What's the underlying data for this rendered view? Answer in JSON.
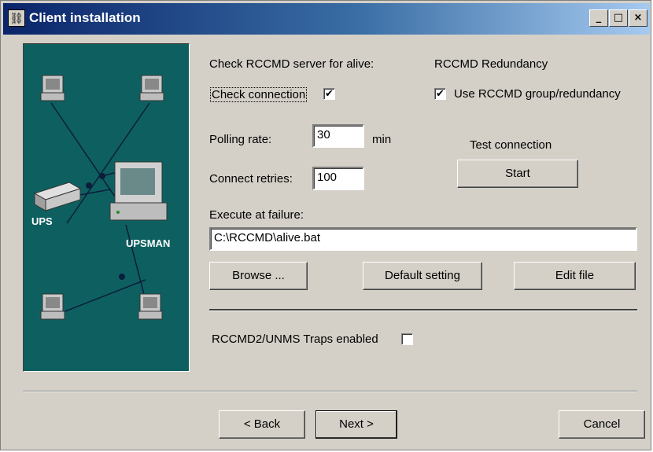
{
  "window": {
    "title": "Client installation",
    "minimize": "_",
    "maximize": "□",
    "close": "×"
  },
  "illustration": {
    "ups_label": "UPS",
    "upsman_label": "UPSMAN"
  },
  "alive": {
    "heading": "Check RCCMD server for alive:",
    "check_connection_label": "Check connection",
    "check_connection_checked": true,
    "check_mark": "✔"
  },
  "redundancy": {
    "heading": "RCCMD Redundancy",
    "use_group_label": "Use RCCMD group/redundancy",
    "use_group_checked": true
  },
  "polling": {
    "label": "Polling rate:",
    "value": "30",
    "unit": "min"
  },
  "retries": {
    "label": "Connect retries:",
    "value": "100"
  },
  "test": {
    "heading": "Test connection",
    "start_button": "Start"
  },
  "failure": {
    "label": "Execute at failure:",
    "path": "C:\\RCCMD\\alive.bat"
  },
  "actions": {
    "browse": "Browse ...",
    "default": "Default setting",
    "edit": "Edit file"
  },
  "traps": {
    "label": "RCCMD2/UNMS Traps enabled",
    "checked": false
  },
  "nav": {
    "back": "< Back",
    "next": "Next >",
    "cancel": "Cancel"
  }
}
